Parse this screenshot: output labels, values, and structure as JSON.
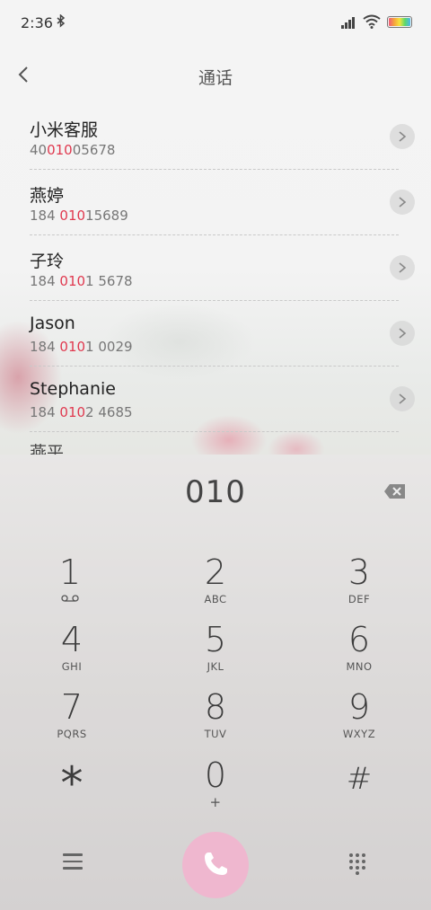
{
  "status_bar": {
    "time": "2:36",
    "bluetooth_icon": "bluetooth-icon",
    "signal_icon": "signal-icon",
    "wifi_icon": "wifi-icon",
    "battery_icon": "battery-icon"
  },
  "header": {
    "title": "通话",
    "back_icon": "back-chevron-icon"
  },
  "contacts": [
    {
      "name": "小米客服",
      "number_pre": "40",
      "number_hl": "010",
      "number_post": "05678"
    },
    {
      "name": "燕婷",
      "number_pre": "184 ",
      "number_hl": "010",
      "number_post": "15689"
    },
    {
      "name": "子玲",
      "number_pre": "184 ",
      "number_hl": "010",
      "number_post": "1 5678"
    },
    {
      "name": "Jason",
      "number_pre": "184 ",
      "number_hl": "010",
      "number_post": "1 0029"
    },
    {
      "name": "Stephanie",
      "number_pre": "184 ",
      "number_hl": "010",
      "number_post": "2 4685"
    }
  ],
  "partial_contact_name": "燕平",
  "colors": {
    "highlight": "#e0394f",
    "call_button": "#efb7cf"
  },
  "dialer": {
    "dialed_number": "010",
    "keys": [
      {
        "digit": "1",
        "letters": "",
        "icon": "voicemail-icon"
      },
      {
        "digit": "2",
        "letters": "ABC"
      },
      {
        "digit": "3",
        "letters": "DEF"
      },
      {
        "digit": "4",
        "letters": "GHI"
      },
      {
        "digit": "5",
        "letters": "JKL"
      },
      {
        "digit": "6",
        "letters": "MNO"
      },
      {
        "digit": "7",
        "letters": "PQRS"
      },
      {
        "digit": "8",
        "letters": "TUV"
      },
      {
        "digit": "9",
        "letters": "WXYZ"
      },
      {
        "digit": "*",
        "letters": ""
      },
      {
        "digit": "0",
        "letters": "+"
      },
      {
        "digit": "#",
        "letters": ""
      }
    ]
  }
}
